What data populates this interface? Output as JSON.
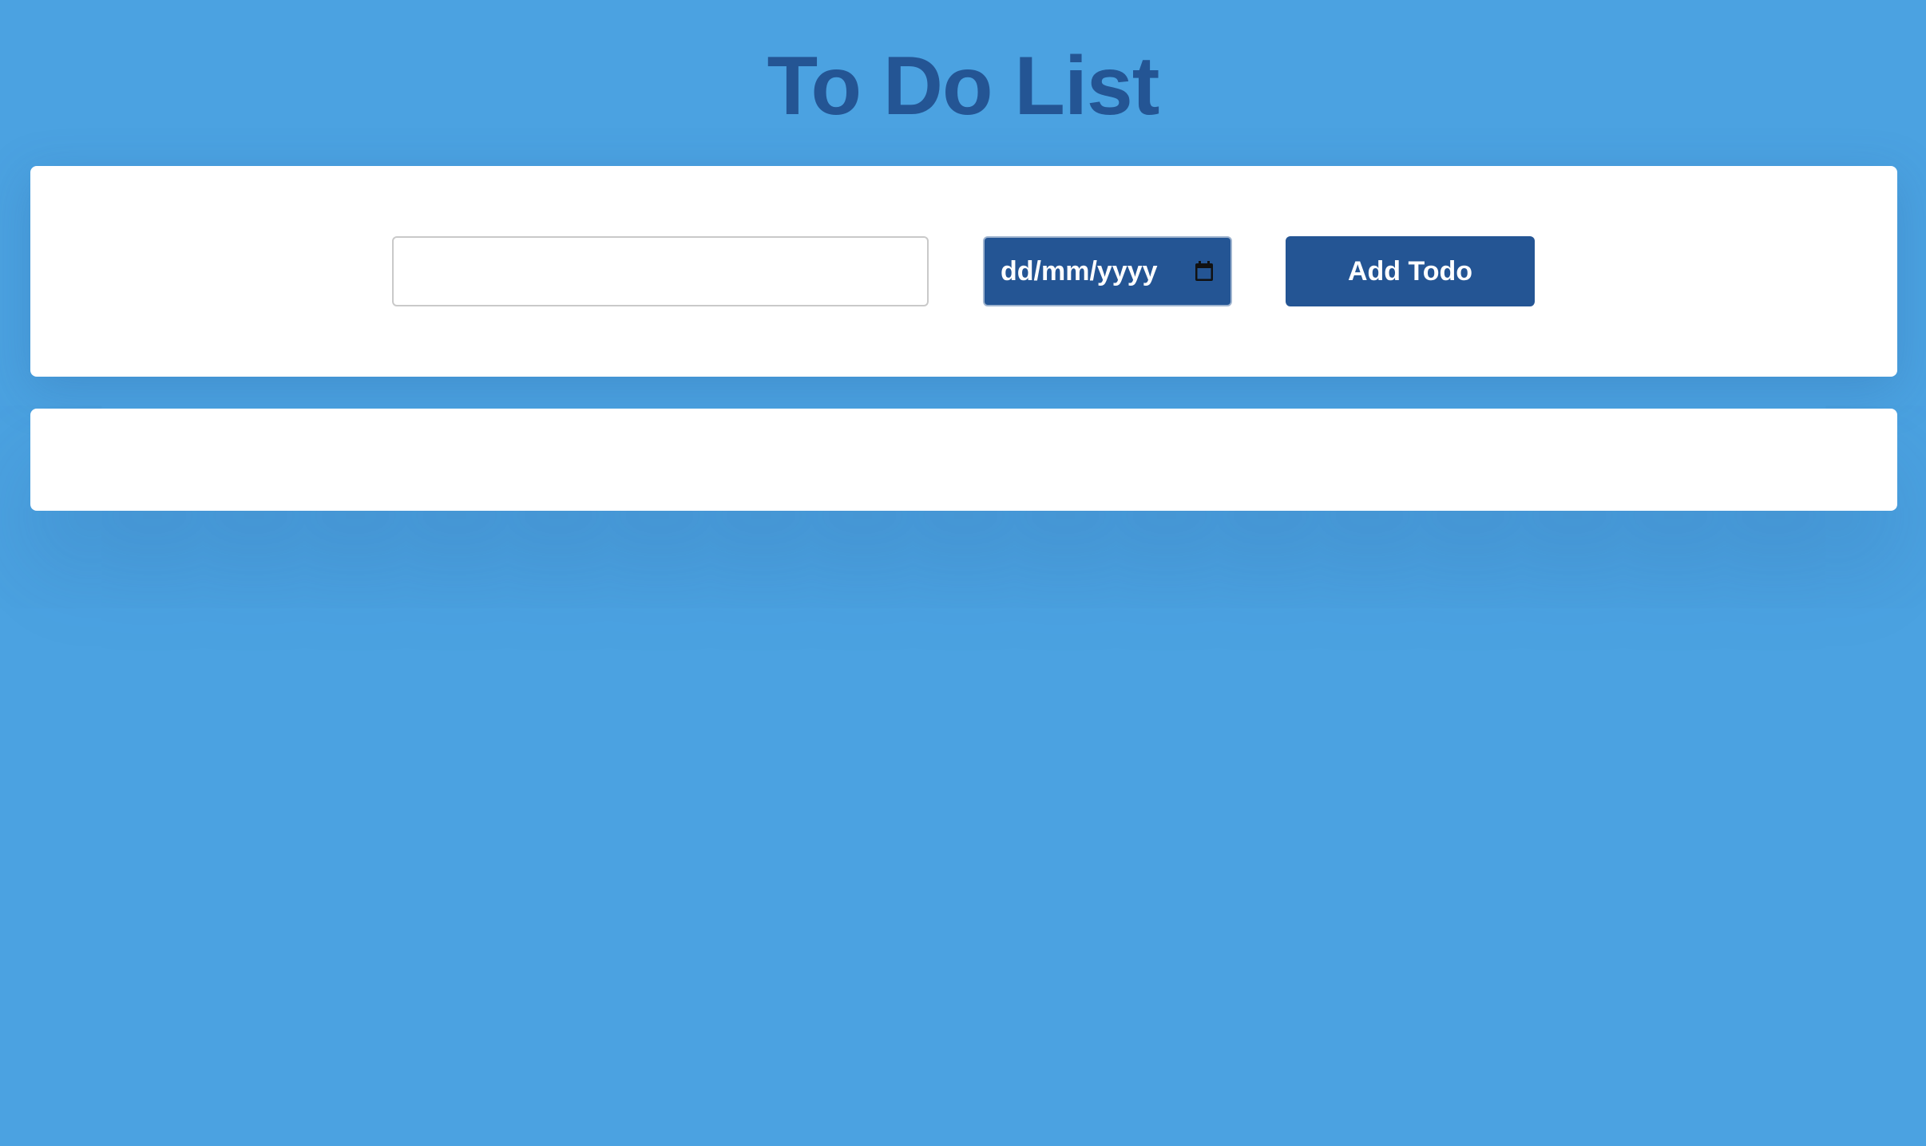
{
  "header": {
    "title": "To Do List"
  },
  "form": {
    "todo_input_value": "",
    "todo_input_placeholder": "",
    "date_placeholder": "dd/mm/yyyy",
    "date_icon": "calendar-icon",
    "add_button_label": "Add Todo"
  },
  "todo_list": {
    "items": []
  },
  "colors": {
    "background": "#4ba2e1",
    "accent": "#245594",
    "card": "#ffffff"
  }
}
